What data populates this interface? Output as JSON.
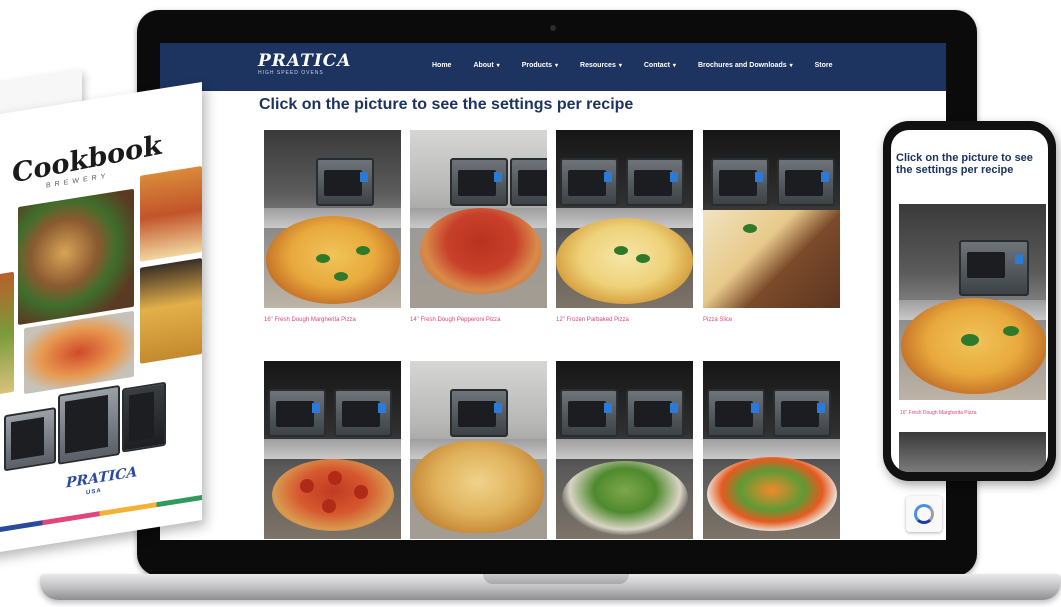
{
  "site": {
    "logo": "PRATICA",
    "logo_sub": "HIGH SPEED OVENS",
    "nav": [
      {
        "label": "Home",
        "has_caret": false
      },
      {
        "label": "About",
        "has_caret": true
      },
      {
        "label": "Products",
        "has_caret": true
      },
      {
        "label": "Resources",
        "has_caret": true
      },
      {
        "label": "Contact",
        "has_caret": true
      },
      {
        "label": "Brochures and Downloads",
        "has_caret": true
      },
      {
        "label": "Store",
        "has_caret": false
      }
    ],
    "caret": "▾",
    "heading": "Click on the picture to see the settings per recipe"
  },
  "recipes": [
    {
      "caption": "16\" Fresh Dough Margherita Pizza",
      "photo": "margherita-pizza"
    },
    {
      "caption": "14\" Fresh Dough Pepperoni Pizza",
      "photo": "pepperoni-pizza"
    },
    {
      "caption": "12\" Frozen Parbaked Pizza",
      "photo": "frozen-parbaked-pizza"
    },
    {
      "caption": "Pizza Slice",
      "photo": "pizza-slice"
    },
    {
      "caption": "",
      "photo": "pepperoni-pizza-small"
    },
    {
      "caption": "",
      "photo": "flatbread"
    },
    {
      "caption": "",
      "photo": "roasted-vegetables"
    },
    {
      "caption": "",
      "photo": "vegetable-salad"
    }
  ],
  "cookbook": {
    "title": "Cookbook",
    "subtitle": "BREWERY",
    "logo": "PRATICA",
    "logo_sub": "USA"
  },
  "phone": {
    "heading": "Click on the picture to see the settings per recipe",
    "caption": "16\" Fresh Dough Margherita Pizza"
  },
  "colors": {
    "nav_bg": "#1d3461",
    "heading": "#1d3461",
    "caption_link": "#e0457b",
    "brand_blue": "#2a4aa0"
  }
}
